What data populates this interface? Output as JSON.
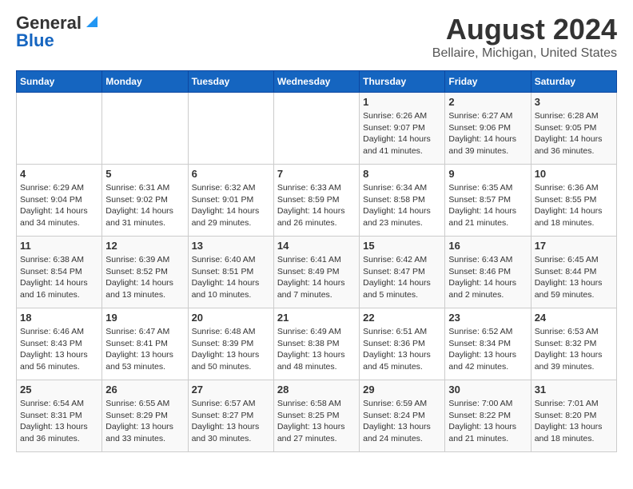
{
  "header": {
    "logo_line1": "General",
    "logo_line2": "Blue",
    "main_title": "August 2024",
    "subtitle": "Bellaire, Michigan, United States"
  },
  "weekdays": [
    "Sunday",
    "Monday",
    "Tuesday",
    "Wednesday",
    "Thursday",
    "Friday",
    "Saturday"
  ],
  "weeks": [
    [
      {
        "day": "",
        "info": ""
      },
      {
        "day": "",
        "info": ""
      },
      {
        "day": "",
        "info": ""
      },
      {
        "day": "",
        "info": ""
      },
      {
        "day": "1",
        "info": "Sunrise: 6:26 AM\nSunset: 9:07 PM\nDaylight: 14 hours\nand 41 minutes."
      },
      {
        "day": "2",
        "info": "Sunrise: 6:27 AM\nSunset: 9:06 PM\nDaylight: 14 hours\nand 39 minutes."
      },
      {
        "day": "3",
        "info": "Sunrise: 6:28 AM\nSunset: 9:05 PM\nDaylight: 14 hours\nand 36 minutes."
      }
    ],
    [
      {
        "day": "4",
        "info": "Sunrise: 6:29 AM\nSunset: 9:04 PM\nDaylight: 14 hours\nand 34 minutes."
      },
      {
        "day": "5",
        "info": "Sunrise: 6:31 AM\nSunset: 9:02 PM\nDaylight: 14 hours\nand 31 minutes."
      },
      {
        "day": "6",
        "info": "Sunrise: 6:32 AM\nSunset: 9:01 PM\nDaylight: 14 hours\nand 29 minutes."
      },
      {
        "day": "7",
        "info": "Sunrise: 6:33 AM\nSunset: 8:59 PM\nDaylight: 14 hours\nand 26 minutes."
      },
      {
        "day": "8",
        "info": "Sunrise: 6:34 AM\nSunset: 8:58 PM\nDaylight: 14 hours\nand 23 minutes."
      },
      {
        "day": "9",
        "info": "Sunrise: 6:35 AM\nSunset: 8:57 PM\nDaylight: 14 hours\nand 21 minutes."
      },
      {
        "day": "10",
        "info": "Sunrise: 6:36 AM\nSunset: 8:55 PM\nDaylight: 14 hours\nand 18 minutes."
      }
    ],
    [
      {
        "day": "11",
        "info": "Sunrise: 6:38 AM\nSunset: 8:54 PM\nDaylight: 14 hours\nand 16 minutes."
      },
      {
        "day": "12",
        "info": "Sunrise: 6:39 AM\nSunset: 8:52 PM\nDaylight: 14 hours\nand 13 minutes."
      },
      {
        "day": "13",
        "info": "Sunrise: 6:40 AM\nSunset: 8:51 PM\nDaylight: 14 hours\nand 10 minutes."
      },
      {
        "day": "14",
        "info": "Sunrise: 6:41 AM\nSunset: 8:49 PM\nDaylight: 14 hours\nand 7 minutes."
      },
      {
        "day": "15",
        "info": "Sunrise: 6:42 AM\nSunset: 8:47 PM\nDaylight: 14 hours\nand 5 minutes."
      },
      {
        "day": "16",
        "info": "Sunrise: 6:43 AM\nSunset: 8:46 PM\nDaylight: 14 hours\nand 2 minutes."
      },
      {
        "day": "17",
        "info": "Sunrise: 6:45 AM\nSunset: 8:44 PM\nDaylight: 13 hours\nand 59 minutes."
      }
    ],
    [
      {
        "day": "18",
        "info": "Sunrise: 6:46 AM\nSunset: 8:43 PM\nDaylight: 13 hours\nand 56 minutes."
      },
      {
        "day": "19",
        "info": "Sunrise: 6:47 AM\nSunset: 8:41 PM\nDaylight: 13 hours\nand 53 minutes."
      },
      {
        "day": "20",
        "info": "Sunrise: 6:48 AM\nSunset: 8:39 PM\nDaylight: 13 hours\nand 50 minutes."
      },
      {
        "day": "21",
        "info": "Sunrise: 6:49 AM\nSunset: 8:38 PM\nDaylight: 13 hours\nand 48 minutes."
      },
      {
        "day": "22",
        "info": "Sunrise: 6:51 AM\nSunset: 8:36 PM\nDaylight: 13 hours\nand 45 minutes."
      },
      {
        "day": "23",
        "info": "Sunrise: 6:52 AM\nSunset: 8:34 PM\nDaylight: 13 hours\nand 42 minutes."
      },
      {
        "day": "24",
        "info": "Sunrise: 6:53 AM\nSunset: 8:32 PM\nDaylight: 13 hours\nand 39 minutes."
      }
    ],
    [
      {
        "day": "25",
        "info": "Sunrise: 6:54 AM\nSunset: 8:31 PM\nDaylight: 13 hours\nand 36 minutes."
      },
      {
        "day": "26",
        "info": "Sunrise: 6:55 AM\nSunset: 8:29 PM\nDaylight: 13 hours\nand 33 minutes."
      },
      {
        "day": "27",
        "info": "Sunrise: 6:57 AM\nSunset: 8:27 PM\nDaylight: 13 hours\nand 30 minutes."
      },
      {
        "day": "28",
        "info": "Sunrise: 6:58 AM\nSunset: 8:25 PM\nDaylight: 13 hours\nand 27 minutes."
      },
      {
        "day": "29",
        "info": "Sunrise: 6:59 AM\nSunset: 8:24 PM\nDaylight: 13 hours\nand 24 minutes."
      },
      {
        "day": "30",
        "info": "Sunrise: 7:00 AM\nSunset: 8:22 PM\nDaylight: 13 hours\nand 21 minutes."
      },
      {
        "day": "31",
        "info": "Sunrise: 7:01 AM\nSunset: 8:20 PM\nDaylight: 13 hours\nand 18 minutes."
      }
    ]
  ]
}
